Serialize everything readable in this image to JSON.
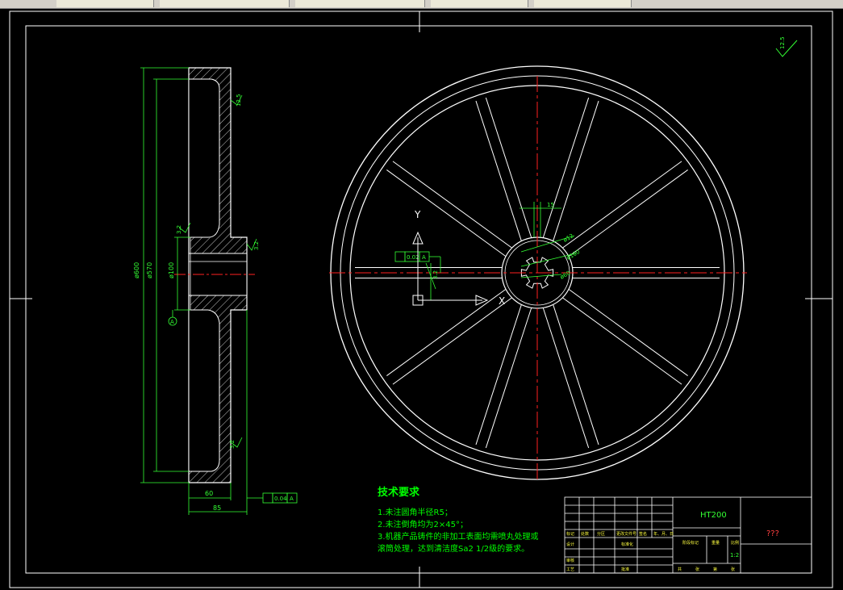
{
  "colors": {
    "background": "#000000",
    "outline": "#ffffff",
    "dimension": "#33ff33",
    "centerline": "#ff2020",
    "tool_green": "#00ff00"
  },
  "side_view": {
    "dims": {
      "d600": "ø600",
      "d570": "ø570",
      "d100": "ø100",
      "w60": "60",
      "w85": "85"
    },
    "rough": {
      "r1": "12.5",
      "r2": "3.2",
      "r3": "3.2",
      "r4": "3.2"
    },
    "datum": "A",
    "tolerance": {
      "value": "0.04",
      "ref": "A"
    }
  },
  "front_view": {
    "dim15": "15",
    "hub_dims": [
      "ø12",
      "ø100",
      "ø60"
    ],
    "keyway_tol": {
      "value": "0.02",
      "ref": "A"
    },
    "rough_hub": "3.2",
    "ucs": {
      "x": "X",
      "y": "Y"
    }
  },
  "corner_rough": "12.5",
  "notes": {
    "title": "技术要求",
    "items": [
      "1.未注圆角半径R5；",
      "2.未注倒角均为2×45°；",
      "3.机器产品铸件的非加工表面均需喷丸处理或",
      "滚筒处理，达到清洁度Sa2 1/2级的要求。"
    ]
  },
  "title_block": {
    "material": "HT200",
    "name": "???",
    "scale": "1:2",
    "cells": [
      "标记",
      "处数",
      "分区",
      "更改文件号",
      "签名",
      "年、月、日",
      "设计",
      "标准化",
      "审核",
      "工艺",
      "批准",
      "阶段标记",
      "重量",
      "比例",
      "共",
      "张",
      "第",
      "张"
    ]
  }
}
